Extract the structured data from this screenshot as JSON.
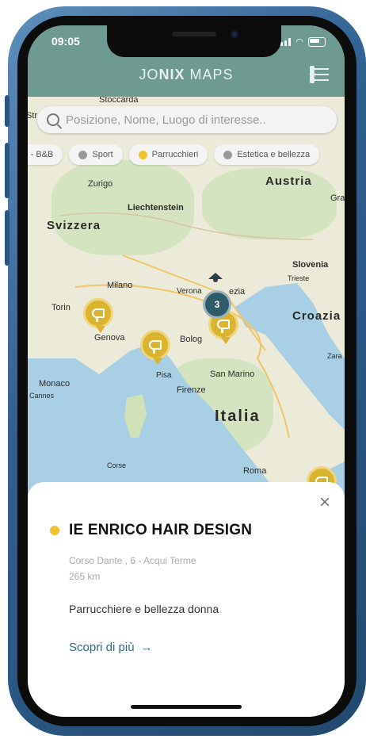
{
  "status": {
    "time": "09:05"
  },
  "header": {
    "logo_light_1": "JO",
    "logo_bold": "NIX",
    "logo_light_2": " MAPS"
  },
  "search": {
    "placeholder": "Posizione, Nome, Luogo di interesse.."
  },
  "filters": [
    {
      "label": "el - B&B",
      "color": "#9a9a9a"
    },
    {
      "label": "Sport",
      "color": "#9a9a9a"
    },
    {
      "label": "Parrucchieri",
      "color": "#f2c230"
    },
    {
      "label": "Estetica e bellezza",
      "color": "#9a9a9a"
    }
  ],
  "map": {
    "labels": {
      "stoccarda": "Stoccarda",
      "zurigo": "Zurigo",
      "austria": "Austria",
      "gra": "Gra",
      "liechtenstein": "Liechtenstein",
      "svizzera": "Svizzera",
      "slovenia": "Slovenia",
      "trieste": "Trieste",
      "milano": "Milano",
      "verona": "Verona",
      "venezia": "ezia",
      "torino": "Torin",
      "croazia": "Croazia",
      "genova": "Genova",
      "bologna": "Bolog",
      "zara": "Zara",
      "monaco": "Monaco",
      "cannes": "Cannes",
      "pisa": "Pisa",
      "san_marino": "San Marino",
      "firenze": "Firenze",
      "italia": "Italia",
      "corse": "Corse",
      "roma": "Roma",
      "str": "Str"
    },
    "cluster_count": "3"
  },
  "detail": {
    "close_icon": "×",
    "category_color": "#f2c230",
    "name": "IE ENRICO HAIR DESIGN",
    "address": "Corso Dante , 6 - Acqui Terme",
    "distance": "265 km",
    "description": "Parrucchiere e bellezza donna",
    "more_label": "Scopri di più",
    "more_arrow": "→"
  }
}
